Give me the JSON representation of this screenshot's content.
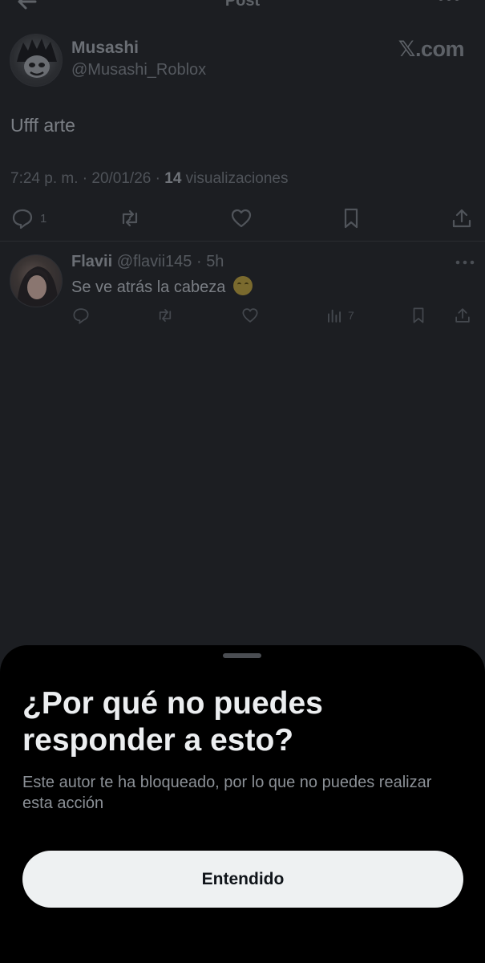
{
  "topbar": {
    "title": "Post"
  },
  "post": {
    "author_name": "Musashi",
    "author_handle": "@Musashi_Roblox",
    "brand": "𝕏.com",
    "text": "Ufff arte",
    "time": "7:24 p. m.",
    "date": "20/01/26",
    "views_count": "14",
    "views_label": "visualizaciones",
    "reply_count": "1"
  },
  "reply": {
    "name": "Flavii",
    "handle": "@flavii145",
    "age": "5h",
    "text": "Se ve atrás la cabeza",
    "views_count": "7"
  },
  "sheet": {
    "title": "¿Por qué no puedes responder a esto?",
    "description": "Este autor te ha bloqueado, por lo que no puedes realizar esta acción",
    "button_label": "Entendido"
  },
  "icons": {
    "back": "arrow-left-icon",
    "more": "more-horizontal-icon",
    "reply": "comment-icon",
    "repost": "repost-icon",
    "like": "heart-icon",
    "bookmark": "bookmark-icon",
    "share": "share-icon",
    "views": "bar-chart-icon",
    "emoji": "loudly-crying-face"
  }
}
